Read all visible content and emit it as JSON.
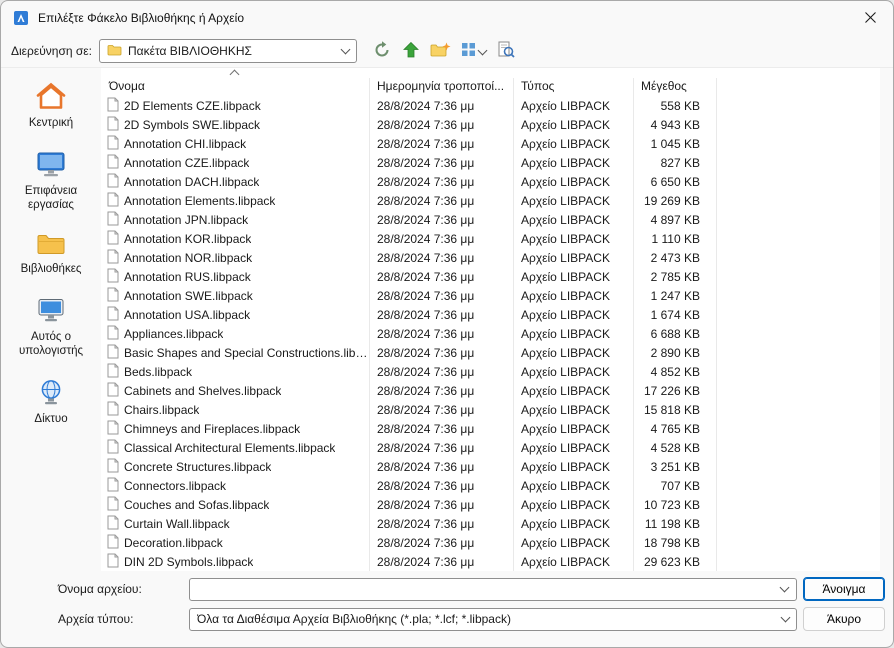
{
  "window": {
    "title": "Επιλέξτε Φάκελο Βιβλιοθήκης ή Αρχείο"
  },
  "toolbar": {
    "look_in_label": "Διερεύνηση σε:",
    "look_in_value": "Πακέτα ΒΙΒΛΙΟΘΗΚΗΣ",
    "icons": [
      "back-icon",
      "up-one-level-icon",
      "new-folder-icon",
      "views-icon",
      "preview-icon"
    ]
  },
  "sidebar": {
    "items": [
      {
        "label": "Κεντρική",
        "icon": "home-icon"
      },
      {
        "label": "Επιφάνεια εργασίας",
        "icon": "desktop-icon"
      },
      {
        "label": "Βιβλιοθήκες",
        "icon": "libraries-icon"
      },
      {
        "label": "Αυτός ο υπολογιστής",
        "icon": "this-pc-icon"
      },
      {
        "label": "Δίκτυο",
        "icon": "network-icon"
      }
    ]
  },
  "file_list": {
    "columns": [
      "Όνομα",
      "Ημερομηνία τροποποί...",
      "Τύπος",
      "Μέγεθος"
    ],
    "sort": {
      "column": "Όνομα",
      "direction": "ascending"
    },
    "rows": [
      {
        "name": "2D Elements CZE.libpack",
        "modified": "28/8/2024 7:36 μμ",
        "type": "Αρχείο LIBPACK",
        "size": "558 KB"
      },
      {
        "name": "2D Symbols SWE.libpack",
        "modified": "28/8/2024 7:36 μμ",
        "type": "Αρχείο LIBPACK",
        "size": "4 943 KB"
      },
      {
        "name": "Annotation CHI.libpack",
        "modified": "28/8/2024 7:36 μμ",
        "type": "Αρχείο LIBPACK",
        "size": "1 045 KB"
      },
      {
        "name": "Annotation CZE.libpack",
        "modified": "28/8/2024 7:36 μμ",
        "type": "Αρχείο LIBPACK",
        "size": "827 KB"
      },
      {
        "name": "Annotation DACH.libpack",
        "modified": "28/8/2024 7:36 μμ",
        "type": "Αρχείο LIBPACK",
        "size": "6 650 KB"
      },
      {
        "name": "Annotation Elements.libpack",
        "modified": "28/8/2024 7:36 μμ",
        "type": "Αρχείο LIBPACK",
        "size": "19 269 KB"
      },
      {
        "name": "Annotation JPN.libpack",
        "modified": "28/8/2024 7:36 μμ",
        "type": "Αρχείο LIBPACK",
        "size": "4 897 KB"
      },
      {
        "name": "Annotation KOR.libpack",
        "modified": "28/8/2024 7:36 μμ",
        "type": "Αρχείο LIBPACK",
        "size": "1 110 KB"
      },
      {
        "name": "Annotation NOR.libpack",
        "modified": "28/8/2024 7:36 μμ",
        "type": "Αρχείο LIBPACK",
        "size": "2 473 KB"
      },
      {
        "name": "Annotation RUS.libpack",
        "modified": "28/8/2024 7:36 μμ",
        "type": "Αρχείο LIBPACK",
        "size": "2 785 KB"
      },
      {
        "name": "Annotation SWE.libpack",
        "modified": "28/8/2024 7:36 μμ",
        "type": "Αρχείο LIBPACK",
        "size": "1 247 KB"
      },
      {
        "name": "Annotation USA.libpack",
        "modified": "28/8/2024 7:36 μμ",
        "type": "Αρχείο LIBPACK",
        "size": "1 674 KB"
      },
      {
        "name": "Appliances.libpack",
        "modified": "28/8/2024 7:36 μμ",
        "type": "Αρχείο LIBPACK",
        "size": "6 688 KB"
      },
      {
        "name": "Basic Shapes and Special Constructions.libp...",
        "modified": "28/8/2024 7:36 μμ",
        "type": "Αρχείο LIBPACK",
        "size": "2 890 KB"
      },
      {
        "name": "Beds.libpack",
        "modified": "28/8/2024 7:36 μμ",
        "type": "Αρχείο LIBPACK",
        "size": "4 852 KB"
      },
      {
        "name": "Cabinets and Shelves.libpack",
        "modified": "28/8/2024 7:36 μμ",
        "type": "Αρχείο LIBPACK",
        "size": "17 226 KB"
      },
      {
        "name": "Chairs.libpack",
        "modified": "28/8/2024 7:36 μμ",
        "type": "Αρχείο LIBPACK",
        "size": "15 818 KB"
      },
      {
        "name": "Chimneys and Fireplaces.libpack",
        "modified": "28/8/2024 7:36 μμ",
        "type": "Αρχείο LIBPACK",
        "size": "4 765 KB"
      },
      {
        "name": "Classical Architectural Elements.libpack",
        "modified": "28/8/2024 7:36 μμ",
        "type": "Αρχείο LIBPACK",
        "size": "4 528 KB"
      },
      {
        "name": "Concrete Structures.libpack",
        "modified": "28/8/2024 7:36 μμ",
        "type": "Αρχείο LIBPACK",
        "size": "3 251 KB"
      },
      {
        "name": "Connectors.libpack",
        "modified": "28/8/2024 7:36 μμ",
        "type": "Αρχείο LIBPACK",
        "size": "707 KB"
      },
      {
        "name": "Couches and Sofas.libpack",
        "modified": "28/8/2024 7:36 μμ",
        "type": "Αρχείο LIBPACK",
        "size": "10 723 KB"
      },
      {
        "name": "Curtain Wall.libpack",
        "modified": "28/8/2024 7:36 μμ",
        "type": "Αρχείο LIBPACK",
        "size": "11 198 KB"
      },
      {
        "name": "Decoration.libpack",
        "modified": "28/8/2024 7:36 μμ",
        "type": "Αρχείο LIBPACK",
        "size": "18 798 KB"
      },
      {
        "name": "DIN 2D Symbols.libpack",
        "modified": "28/8/2024 7:36 μμ",
        "type": "Αρχείο LIBPACK",
        "size": "29 623 KB"
      }
    ]
  },
  "footer": {
    "file_name_label": "Όνομα αρχείου:",
    "file_name_value": "",
    "open_button": "Άνοιγμα",
    "file_type_label": "Αρχεία τύπου:",
    "file_type_value": "Όλα τα Διαθέσιμα Αρχεία Βιβλιοθήκης (*.pla; *.lcf; *.libpack)",
    "cancel_button": "Άκυρο"
  },
  "colors": {
    "accent": "#0067C0",
    "folder_yellow": "#F8D264",
    "up_green": "#3BA43B",
    "home_orange": "#E8762C"
  }
}
